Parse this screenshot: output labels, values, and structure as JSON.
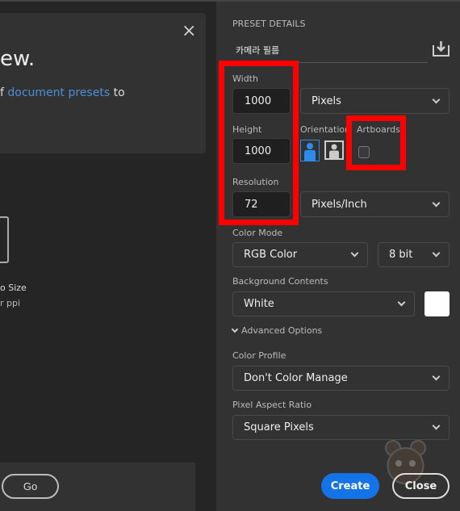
{
  "left": {
    "title": "ew.",
    "desc_prefix": "f ",
    "desc_link": "document presets",
    "desc_suffix": " to",
    "size_label": "o Size",
    "ppi_label": "r ppi",
    "go_label": "Go",
    "close_symbol": "×"
  },
  "details": {
    "section_title": "PRESET DETAILS",
    "preset_name": "카메라 필름",
    "width_label": "Width",
    "width_value": "1000",
    "width_unit": "Pixels",
    "height_label": "Height",
    "height_value": "1000",
    "orientation_label": "Orientation",
    "orientation_selected": "portrait",
    "artboards_label": "Artboards",
    "artboards_checked": false,
    "resolution_label": "Resolution",
    "resolution_value": "72",
    "resolution_unit": "Pixels/Inch",
    "color_mode_label": "Color Mode",
    "color_mode": "RGB Color",
    "bit_depth": "8 bit",
    "background_label": "Background Contents",
    "background": "White",
    "background_swatch": "#ffffff",
    "advanced_label": "Advanced Options",
    "color_profile_label": "Color Profile",
    "color_profile": "Don't Color Manage",
    "pixel_aspect_label": "Pixel Aspect Ratio",
    "pixel_aspect": "Square Pixels",
    "create_label": "Create",
    "close_label": "Close"
  },
  "colors": {
    "accent": "#1473e6",
    "highlight": "#ff0000"
  }
}
